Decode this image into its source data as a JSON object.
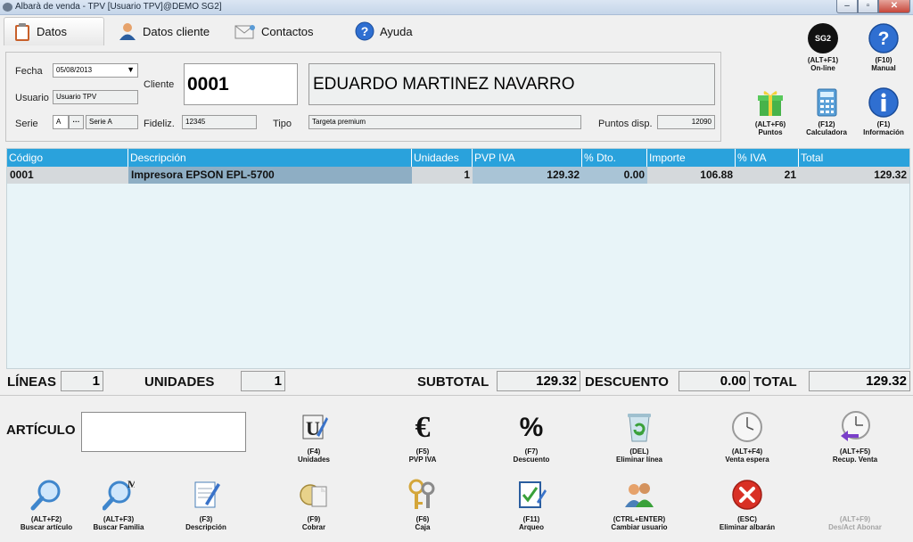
{
  "window": {
    "title": "Albarà de venda - TPV [Usuario TPV]@DEMO SG2]",
    "min": "–",
    "max": "▫",
    "close": "✕"
  },
  "tabs": [
    {
      "label": "Datos",
      "icon": "clipboard-icon"
    },
    {
      "label": "Datos cliente",
      "icon": "user-icon"
    },
    {
      "label": "Contactos",
      "icon": "envelope-icon"
    },
    {
      "label": "Ayuda",
      "icon": "help-icon"
    }
  ],
  "form": {
    "fecha_label": "Fecha",
    "fecha_value": "05/08/2013",
    "usuario_label": "Usuario",
    "usuario_value": "Usuario TPV",
    "serie_label": "Serie",
    "serie_code": "A",
    "serie_name": "Serie A",
    "ellipsis": "···",
    "cliente_label": "Cliente",
    "cliente_code": "0001",
    "cliente_name": "EDUARDO MARTINEZ NAVARRO",
    "fideliz_label": "Fideliz.",
    "fideliz_value": "12345",
    "tipo_label": "Tipo",
    "tipo_value": "Targeta premium",
    "puntos_label": "Puntos disp.",
    "puntos_value": "12090"
  },
  "top_actions": [
    {
      "key": "(ALT+F1)",
      "label": "On-line",
      "icon": "sg2-logo-icon"
    },
    {
      "key": "(F10)",
      "label": "Manual",
      "icon": "help-icon"
    },
    {
      "key": "(ALT+F6)",
      "label": "Puntos",
      "icon": "gift-icon"
    },
    {
      "key": "(F12)",
      "label": "Calculadora",
      "icon": "calculator-icon"
    },
    {
      "key": "(F1)",
      "label": "Información",
      "icon": "info-icon"
    }
  ],
  "sg2_logo_text": "SG2",
  "grid": {
    "columns": [
      "Código",
      "Descripción",
      "Unidades",
      "PVP IVA",
      "% Dto.",
      "Importe",
      "% IVA",
      "Total"
    ],
    "rows": [
      [
        "0001",
        "Impresora EPSON EPL-5700",
        "1",
        "129.32",
        "0.00",
        "106.88",
        "21",
        "129.32"
      ]
    ]
  },
  "totals": {
    "lineas_label": "LÍNEAS",
    "lineas_value": "1",
    "unidades_label": "UNIDADES",
    "unidades_value": "1",
    "subtotal_label": "SUBTOTAL",
    "subtotal_value": "129.32",
    "descuento_label": "DESCUENTO",
    "descuento_value": "0.00",
    "total_label": "TOTAL",
    "total_value": "129.32"
  },
  "articulo": {
    "label": "ARTÍCULO",
    "value": ""
  },
  "actions_row1": [
    {
      "key": "(F4)",
      "label": "Unidades",
      "icon": "units-icon"
    },
    {
      "key": "(F5)",
      "label": "PVP IVA",
      "icon": "euro-icon",
      "glyph": "€"
    },
    {
      "key": "(F7)",
      "label": "Descuento",
      "icon": "percent-icon",
      "glyph": "%"
    },
    {
      "key": "(DEL)",
      "label": "Eliminar línea",
      "icon": "recycle-bin-icon"
    },
    {
      "key": "(ALT+F4)",
      "label": "Venta espera",
      "icon": "clock-icon"
    },
    {
      "key": "(ALT+F5)",
      "label": "Recup. Venta",
      "icon": "clock-back-icon"
    }
  ],
  "actions_row2": [
    {
      "key": "(ALT+F2)",
      "label": "Buscar artículo",
      "icon": "magnifier-icon"
    },
    {
      "key": "(ALT+F3)",
      "label": "Buscar Familia",
      "icon": "magnifier-family-icon"
    },
    {
      "key": "(F3)",
      "label": "Descripción",
      "icon": "notepad-pencil-icon"
    },
    {
      "key": "(F9)",
      "label": "Cobrar",
      "icon": "coins-icon"
    },
    {
      "key": "(F6)",
      "label": "Caja",
      "icon": "keys-icon"
    },
    {
      "key": "(F11)",
      "label": "Arqueo",
      "icon": "checklist-icon"
    },
    {
      "key": "(CTRL+ENTER)",
      "label": "Cambiar usuario",
      "icon": "users-icon"
    },
    {
      "key": "(ESC)",
      "label": "Eliminar albarán",
      "icon": "delete-red-icon"
    },
    {
      "key": "(ALT+F9)",
      "label": "Des/Act Abonar",
      "icon": "none",
      "disabled": true
    }
  ]
}
